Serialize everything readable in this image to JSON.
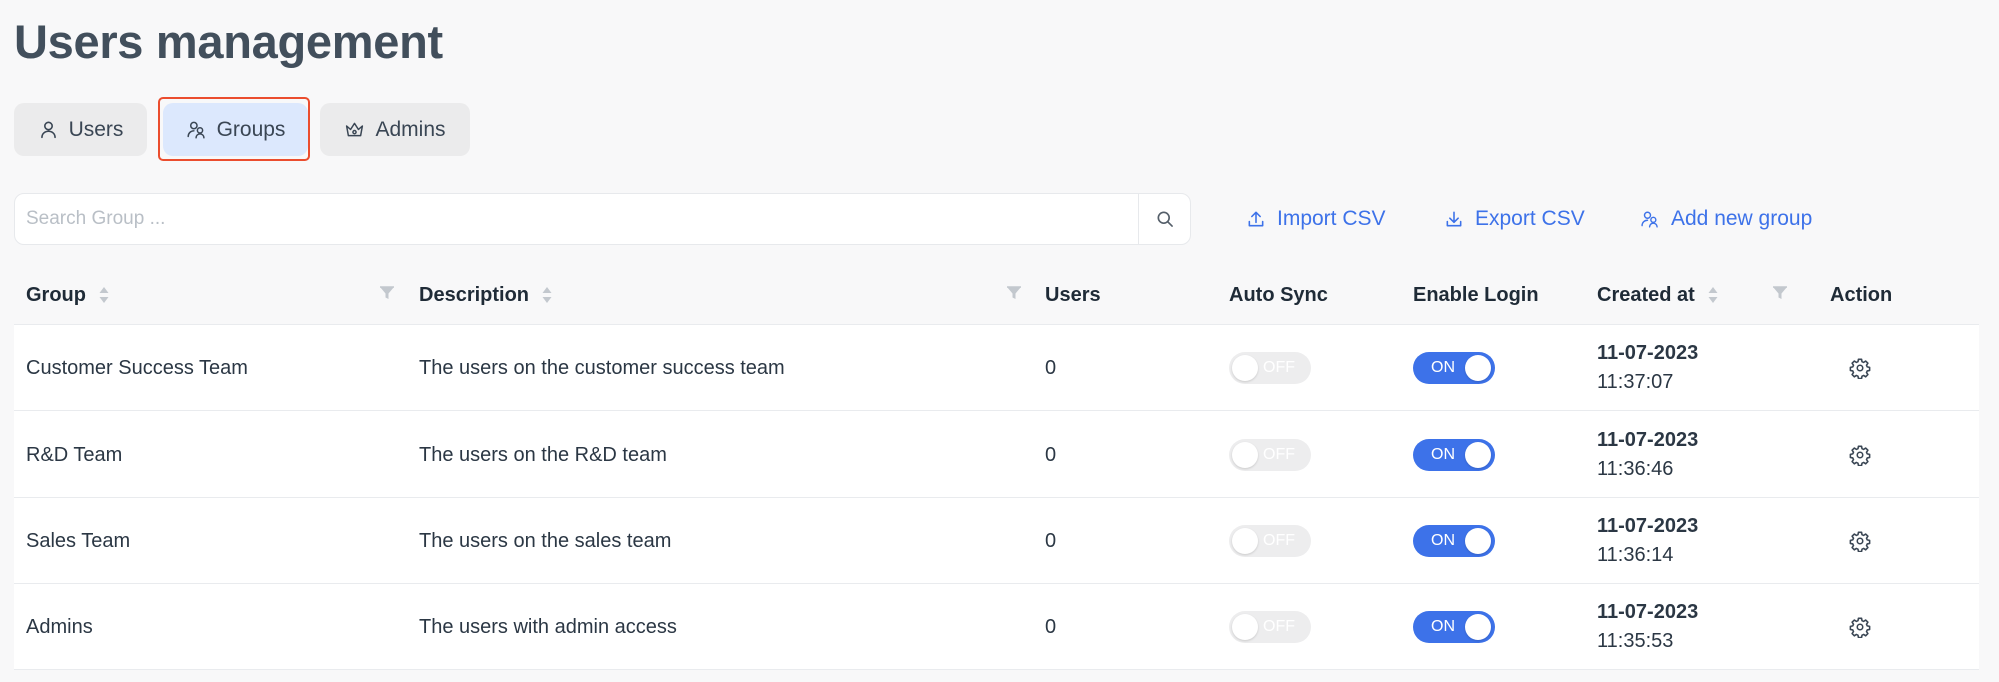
{
  "page": {
    "title": "Users management"
  },
  "tabs": [
    {
      "label": "Users",
      "icon": "user-icon"
    },
    {
      "label": "Groups",
      "icon": "group-icon",
      "selected": true
    },
    {
      "label": "Admins",
      "icon": "crown-icon"
    }
  ],
  "search": {
    "placeholder": "Search Group ...",
    "value": ""
  },
  "actions": {
    "import_label": "Import CSV",
    "export_label": "Export CSV",
    "add_label": "Add new group"
  },
  "table": {
    "columns": {
      "group": "Group",
      "description": "Description",
      "users": "Users",
      "auto_sync": "Auto Sync",
      "enable_login": "Enable Login",
      "created_at": "Created at",
      "action": "Action"
    },
    "rows": [
      {
        "group": "Customer Success Team",
        "description": "The users on the customer success team",
        "users": "0",
        "auto_sync": "OFF",
        "enable_login": "ON",
        "date": "11-07-2023",
        "time": "11:37:07"
      },
      {
        "group": "R&D Team",
        "description": "The users on the R&D team",
        "users": "0",
        "auto_sync": "OFF",
        "enable_login": "ON",
        "date": "11-07-2023",
        "time": "11:36:46"
      },
      {
        "group": "Sales Team",
        "description": "The users on the sales team",
        "users": "0",
        "auto_sync": "OFF",
        "enable_login": "ON",
        "date": "11-07-2023",
        "time": "11:36:14"
      },
      {
        "group": "Admins",
        "description": "The users with admin access",
        "users": "0",
        "auto_sync": "OFF",
        "enable_login": "ON",
        "date": "11-07-2023",
        "time": "11:35:53"
      }
    ]
  },
  "colors": {
    "accent": "#3d72e9",
    "selected_tab_bg": "#dce8fd",
    "highlight_border": "#eb4d2e",
    "toggle_off_bg": "#ededee"
  }
}
